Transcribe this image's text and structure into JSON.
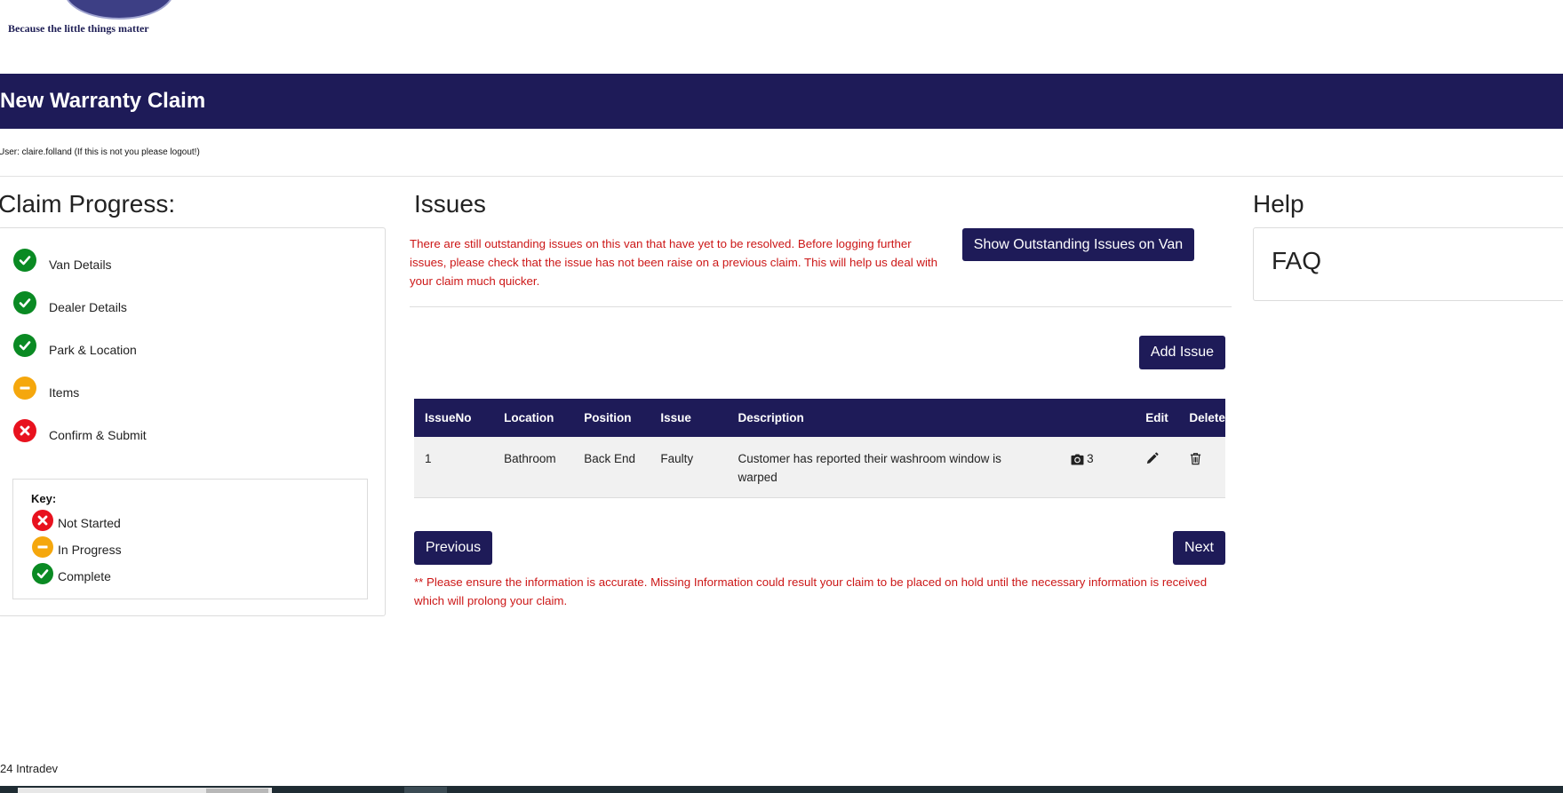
{
  "brand": {
    "tagline": "Because the little things matter",
    "logo_color": "#3d3f85"
  },
  "header": {
    "title": "New Warranty Claim",
    "color": "#1e1b58"
  },
  "user": {
    "line": "User: claire.folland (If this is not you please logout!)"
  },
  "progress": {
    "heading": "Claim Progress:",
    "steps": [
      {
        "label": "Van Details",
        "status": "complete",
        "icon": "check-circle-icon"
      },
      {
        "label": "Dealer Details",
        "status": "complete",
        "icon": "check-circle-icon"
      },
      {
        "label": "Park & Location",
        "status": "complete",
        "icon": "check-circle-icon"
      },
      {
        "label": "Items",
        "status": "in-progress",
        "icon": "minus-circle-icon"
      },
      {
        "label": "Confirm & Submit",
        "status": "not-started",
        "icon": "x-circle-icon"
      }
    ],
    "key": {
      "title": "Key:",
      "items": [
        {
          "label": "Not Started",
          "icon": "x-circle-icon",
          "color": "#e8121e"
        },
        {
          "label": "In Progress",
          "icon": "minus-circle-icon",
          "color": "#f5a70d"
        },
        {
          "label": "Complete",
          "icon": "check-circle-icon",
          "color": "#0a8a23"
        }
      ]
    }
  },
  "issues": {
    "heading": "Issues",
    "warning": "There are still outstanding issues on this van that have yet to be resolved. Before logging further issues, please check that the issue has not been raise on a previous claim. This will help us deal with your claim much quicker.",
    "show_outstanding_label": "Show Outstanding Issues on Van",
    "add_issue_label": "Add Issue",
    "table": {
      "headers": [
        "IssueNo",
        "Location",
        "Position",
        "Issue",
        "Description",
        "",
        "Edit",
        "Delete"
      ],
      "rows": [
        {
          "issue_no": "1",
          "location": "Bathroom",
          "position": "Back End",
          "issue": "Faulty",
          "description": "Customer has reported their washroom window is warped",
          "photo_count": "3",
          "photo_icon": "camera-icon",
          "edit_icon": "pencil-icon",
          "delete_icon": "trash-icon"
        }
      ]
    },
    "previous_label": "Previous",
    "next_label": "Next",
    "footer_warning": "** Please ensure the information is accurate. Missing Information could result your claim to be placed on hold until the necessary information is received which will prolong your claim."
  },
  "help": {
    "heading": "Help",
    "faq_label": "FAQ"
  },
  "footer": {
    "copyright": "24 Intradev"
  },
  "colors": {
    "warning_text": "#cc1717",
    "complete": "#0a8a23",
    "in_progress": "#f5a70d",
    "not_started": "#e8121e"
  }
}
